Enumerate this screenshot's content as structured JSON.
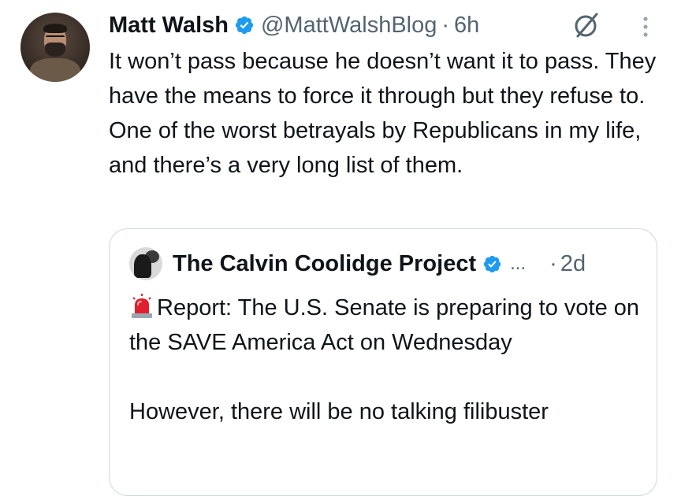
{
  "tweet": {
    "author_name": "Matt Walsh",
    "handle": "@MattWalshBlog",
    "separator": "·",
    "time": "6h",
    "avatar_icon": "user-avatar-photo",
    "text": "It won’t pass because he doesn’t want it to pass. They have the means to force it through but they refuse to. One of the worst betrayals by Republicans in my life, and there’s a very long list of them."
  },
  "quoted_tweet": {
    "author_name": "The Calvin Coolidge Project",
    "ellipsis": "...",
    "separator": "·",
    "time": "2d",
    "avatar_icon": "calvin-coolidge-avatar",
    "report_text": "Report: The U.S. Senate is preparing to vote on the SAVE America Act on Wednesday",
    "second_paragraph": "However, there will be no talking filibuster"
  },
  "icons": {
    "verified": "verified-badge-icon",
    "grok": "grok-icon",
    "more": "more-options-icon",
    "siren": "police-siren-emoji"
  },
  "colors": {
    "text_primary": "#0f1419",
    "text_secondary": "#536471",
    "verified_blue": "#1d9bf0",
    "border": "#cfd9de"
  }
}
